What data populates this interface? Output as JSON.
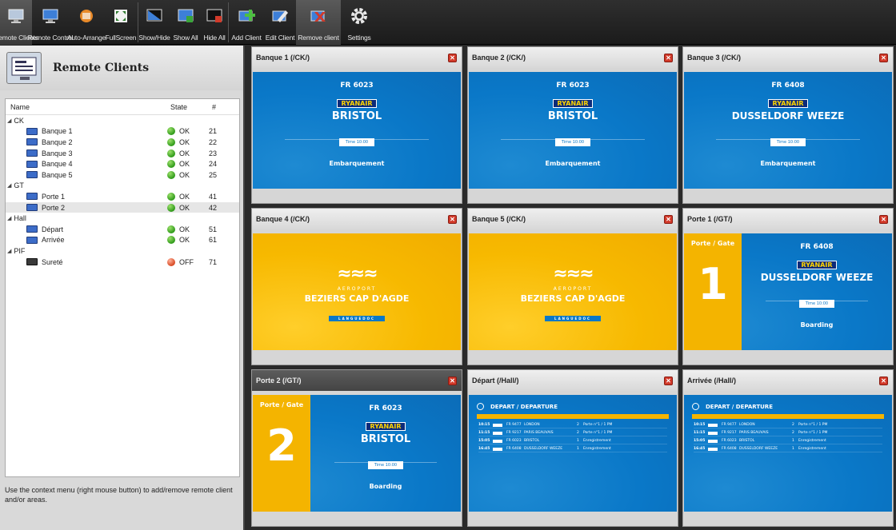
{
  "toolbar": {
    "buttons": [
      {
        "label": "Remote Clients",
        "icon": "remote-clients-icon"
      },
      {
        "label": "Remote Control",
        "icon": "remote-control-icon"
      },
      {
        "label": "Auto-Arrange",
        "icon": "auto-arrange-icon"
      },
      {
        "label": "FullScreen",
        "icon": "fullscreen-icon"
      },
      {
        "label": "Show/Hide",
        "icon": "show-hide-icon"
      },
      {
        "label": "Show All",
        "icon": "show-all-icon"
      },
      {
        "label": "Hide All",
        "icon": "hide-all-icon"
      },
      {
        "label": "Add Client",
        "icon": "add-client-icon"
      },
      {
        "label": "Edit Client",
        "icon": "edit-client-icon"
      },
      {
        "label": "Remove client",
        "icon": "remove-client-icon"
      },
      {
        "label": "Settings",
        "icon": "gear-icon"
      }
    ]
  },
  "left_panel": {
    "title": "Remote Clients",
    "columns": {
      "name": "Name",
      "state": "State",
      "num": "#"
    },
    "tree": [
      {
        "group": "CK",
        "items": [
          {
            "name": "Banque 1",
            "state": "OK",
            "num": "21"
          },
          {
            "name": "Banque 2",
            "state": "OK",
            "num": "22"
          },
          {
            "name": "Banque 3",
            "state": "OK",
            "num": "23"
          },
          {
            "name": "Banque 4",
            "state": "OK",
            "num": "24"
          },
          {
            "name": "Banque 5",
            "state": "OK",
            "num": "25"
          }
        ]
      },
      {
        "group": "GT",
        "items": [
          {
            "name": "Porte 1",
            "state": "OK",
            "num": "41"
          },
          {
            "name": "Porte 2",
            "state": "OK",
            "num": "42"
          }
        ]
      },
      {
        "group": "Hall",
        "items": [
          {
            "name": "Départ",
            "state": "OK",
            "num": "51"
          },
          {
            "name": "Arrivée",
            "state": "OK",
            "num": "61"
          }
        ]
      },
      {
        "group": "PIF",
        "items": [
          {
            "name": "Sureté",
            "state": "OFF",
            "num": "71"
          }
        ]
      }
    ],
    "help": "Use the context menu (right mouse button) to add/remove remote client and/or areas."
  },
  "tiles": [
    {
      "title": "Banque 1 (/CK/)",
      "flight": "FR 6023",
      "airline": "RYANAIR",
      "dest": "BRISTOL",
      "time": "Time 10:00",
      "status": "Embarquement"
    },
    {
      "title": "Banque 2 (/CK/)",
      "flight": "FR 6023",
      "airline": "RYANAIR",
      "dest": "BRISTOL",
      "time": "Time 10:00",
      "status": "Embarquement"
    },
    {
      "title": "Banque 3 (/CK/)",
      "flight": "FR 6408",
      "airline": "RYANAIR",
      "dest": "DUSSELDORF WEEZE",
      "time": "Time 10:00",
      "status": "Embarquement"
    },
    {
      "title": "Banque 4 (/CK/)",
      "small": "AEROPORT",
      "name": "BEZIERS CAP D'AGDE",
      "sub": "LANGUEDOC"
    },
    {
      "title": "Banque 5 (/CK/)",
      "small": "AEROPORT",
      "name": "BEZIERS CAP D'AGDE",
      "sub": "LANGUEDOC"
    },
    {
      "title": "Porte 1 (/GT/)",
      "gate_label": "Porte / Gate",
      "gate_num": "1",
      "flight": "FR 6408",
      "airline": "RYANAIR",
      "dest": "DUSSELDORF WEEZE",
      "time": "Time 10:00",
      "status": "Boarding"
    },
    {
      "title": "Porte 2 (/GT/)",
      "gate_label": "Porte / Gate",
      "gate_num": "2",
      "flight": "FR 6023",
      "airline": "RYANAIR",
      "dest": "BRISTOL",
      "time": "Time 10:00",
      "status": "Boarding"
    },
    {
      "title": "Départ (/Hall/)",
      "board_title": "DEPART / DEPARTURE",
      "rows": [
        {
          "time": "10:15",
          "flight": "FR 9477",
          "dest": "LONDON",
          "gate": "2",
          "status": "Porte n°1 / 1 PM"
        },
        {
          "time": "11:15",
          "flight": "FR 9217",
          "dest": "PARIS BEAUVAIS",
          "gate": "2",
          "status": "Porte n°1 / 1 PM"
        },
        {
          "time": "15:05",
          "flight": "FR 6023",
          "dest": "BRISTOL",
          "gate": "1",
          "status": "Enregistrement"
        },
        {
          "time": "16:45",
          "flight": "FR 6408",
          "dest": "DUSSELDORF WEEZE",
          "gate": "1",
          "status": "Enregistrement"
        }
      ]
    },
    {
      "title": "Arrivée (/Hall/)",
      "board_title": "DEPART / DEPARTURE",
      "rows": [
        {
          "time": "10:15",
          "flight": "FR 9477",
          "dest": "LONDON",
          "gate": "2",
          "status": "Porte n°1 / 1 PM"
        },
        {
          "time": "11:15",
          "flight": "FR 9217",
          "dest": "PARIS BEAUVAIS",
          "gate": "2",
          "status": "Porte n°1 / 1 PM"
        },
        {
          "time": "15:05",
          "flight": "FR 6023",
          "dest": "BRISTOL",
          "gate": "1",
          "status": "Enregistrement"
        },
        {
          "time": "16:45",
          "flight": "FR 6408",
          "dest": "DUSSELDORF WEEZE",
          "gate": "1",
          "status": "Enregistrement"
        }
      ]
    }
  ],
  "colors": {
    "airport_blue": "#0a78c8",
    "airport_yellow": "#f7b900",
    "ok": "#2f9a1a",
    "off": "#d84a24"
  }
}
